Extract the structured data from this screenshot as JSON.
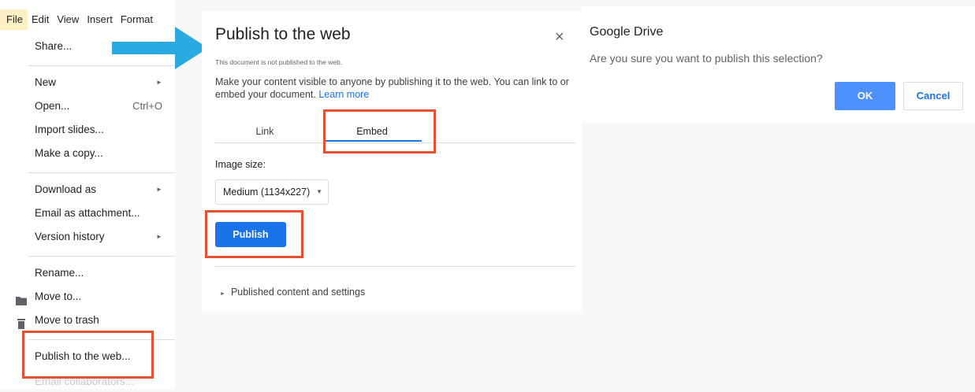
{
  "menubar": {
    "items": [
      "File",
      "Edit",
      "View",
      "Insert",
      "Format"
    ]
  },
  "file_menu": {
    "items": [
      {
        "label": "Share...",
        "submenu": false,
        "shortcut": ""
      },
      {
        "label": "New",
        "submenu": true,
        "shortcut": ""
      },
      {
        "label": "Open...",
        "submenu": false,
        "shortcut": "Ctrl+O"
      },
      {
        "label": "Import slides...",
        "submenu": false,
        "shortcut": ""
      },
      {
        "label": "Make a copy...",
        "submenu": false,
        "shortcut": ""
      },
      {
        "label": "Download as",
        "submenu": true,
        "shortcut": ""
      },
      {
        "label": "Email as attachment...",
        "submenu": false,
        "shortcut": ""
      },
      {
        "label": "Version history",
        "submenu": true,
        "shortcut": ""
      },
      {
        "label": "Rename...",
        "submenu": false,
        "shortcut": ""
      },
      {
        "label": "Move to...",
        "submenu": false,
        "shortcut": "",
        "icon": "folder-icon"
      },
      {
        "label": "Move to trash",
        "submenu": false,
        "shortcut": "",
        "icon": "trash-icon"
      },
      {
        "label": "Publish to the web...",
        "submenu": false,
        "shortcut": "",
        "highlighted": true
      },
      {
        "label": "Email collaborators...",
        "submenu": false,
        "shortcut": "",
        "disabled": true
      }
    ],
    "submenu_glyph": "►"
  },
  "publish_dialog": {
    "title": "Publish to the web",
    "close_glyph": "×",
    "status_note": "This document is not published to the web.",
    "description": "Make your content visible to anyone by publishing it to the web. You can link to or embed your document.",
    "learn_more": "Learn more",
    "tabs": [
      {
        "label": "Link",
        "selected": false
      },
      {
        "label": "Embed",
        "selected": true
      }
    ],
    "image_size_label": "Image size:",
    "image_size_value": "Medium (1134x227)",
    "caret_glyph": "▼",
    "publish_label": "Publish",
    "expander_label": "Published content and settings",
    "expander_glyph": "►"
  },
  "confirm_dialog": {
    "title": "Google Drive",
    "message": "Are you sure you want to publish this selection?",
    "ok_label": "OK",
    "cancel_label": "Cancel"
  },
  "colors": {
    "highlight_box": "#e8512f",
    "arrow": "#29abe2",
    "primary_button": "#1a73e8",
    "ok_button": "#4d90fe",
    "active_menu": "#fdf0c4"
  }
}
